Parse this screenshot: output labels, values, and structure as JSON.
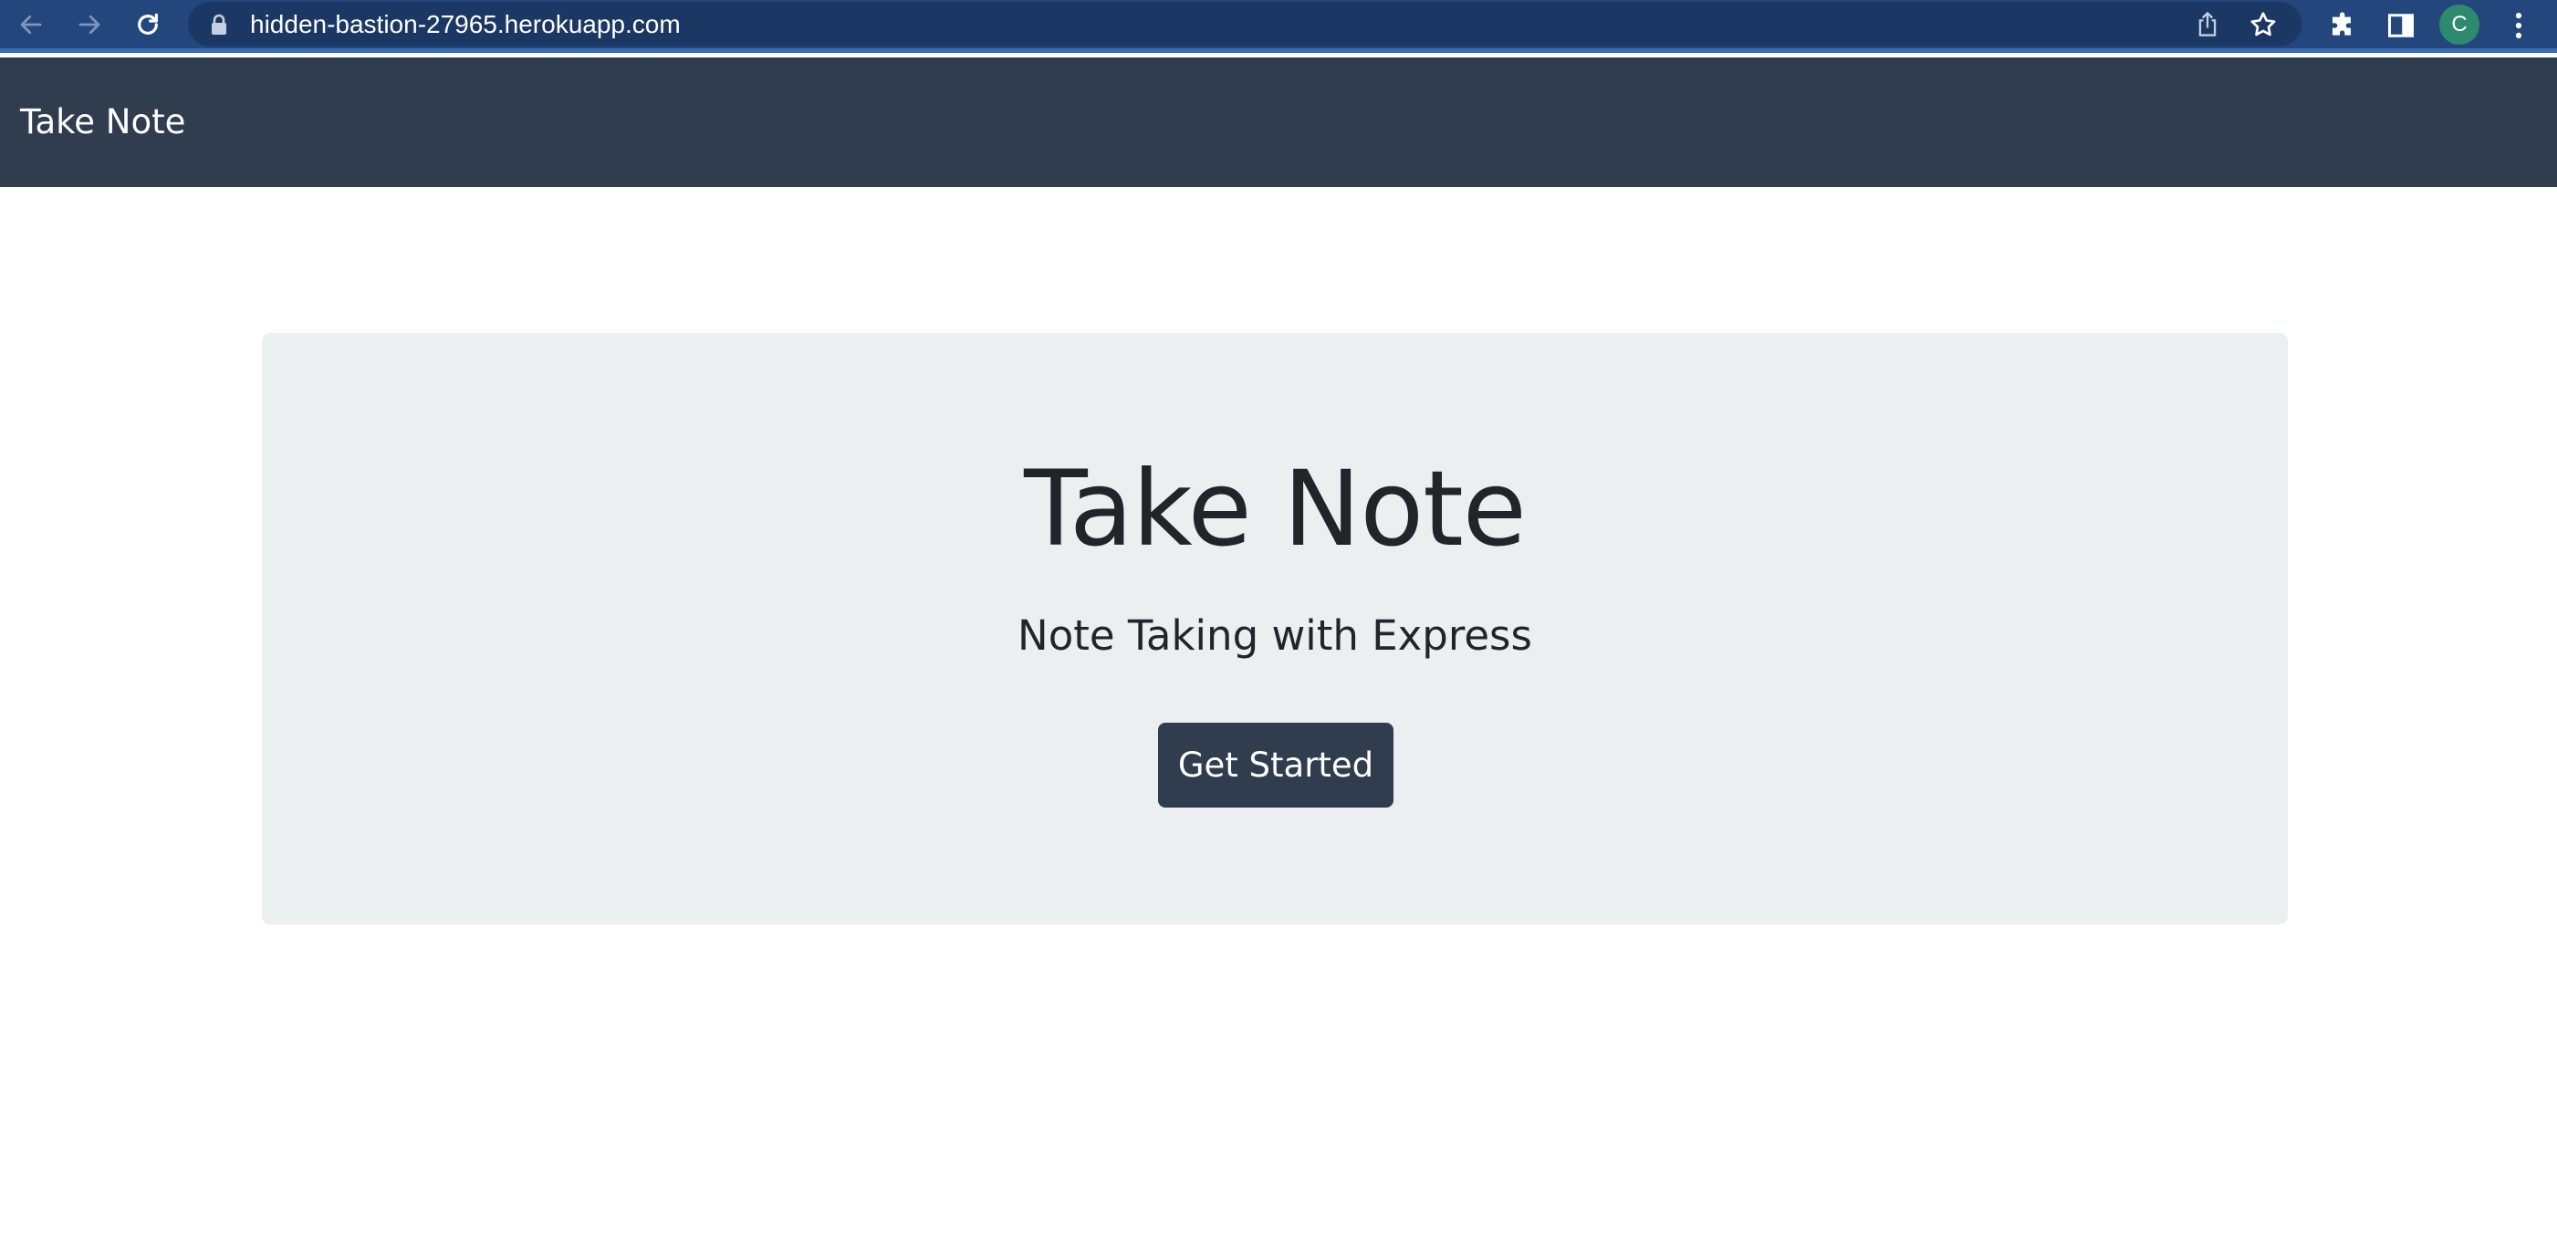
{
  "browser": {
    "url": "hidden-bastion-27965.herokuapp.com",
    "avatar_initial": "C",
    "icons": {
      "back": "arrow-left-icon",
      "forward": "arrow-right-icon",
      "reload": "reload-icon",
      "lock": "lock-icon",
      "share": "share-icon",
      "bookmark": "star-icon",
      "extensions": "puzzle-icon",
      "side_panel": "side-panel-icon",
      "menu": "kebab-menu-icon"
    },
    "colors": {
      "toolbar": "#23467d",
      "omnibox": "#1b3865",
      "avatar": "#2e8a6f"
    }
  },
  "navbar": {
    "brand": "Take Note",
    "background": "#303d4e"
  },
  "hero": {
    "title": "Take Note",
    "subtitle": "Note Taking with Express",
    "cta_label": "Get Started",
    "background": "#eceff0",
    "button_color": "#303d4e"
  }
}
